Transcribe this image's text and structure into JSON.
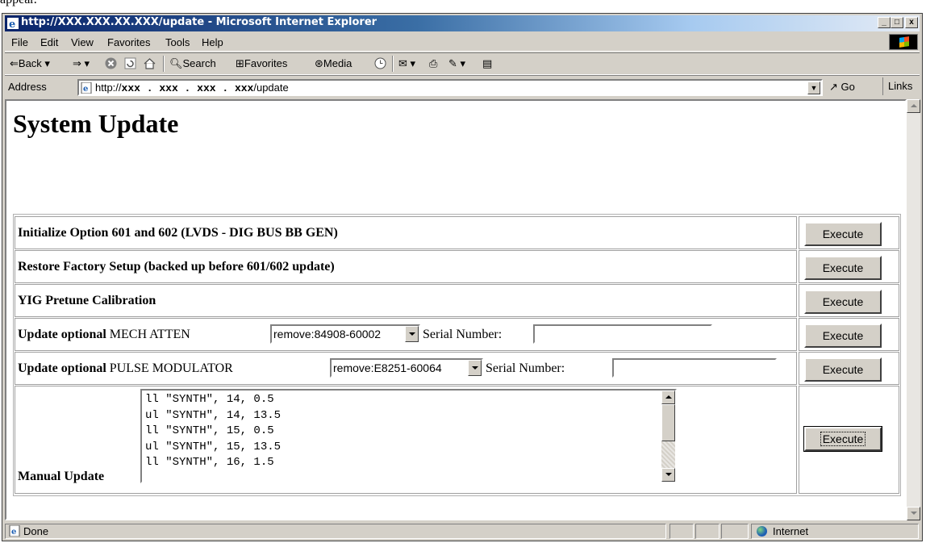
{
  "window": {
    "title": "http://XXX.XXX.XX.XXX/update - Microsoft Internet Explorer",
    "caption_buttons": {
      "minimize": "_",
      "maximize": "□",
      "close": "x"
    }
  },
  "menu": [
    {
      "label": "File"
    },
    {
      "label": "Edit"
    },
    {
      "label": "View"
    },
    {
      "label": "Favorites"
    },
    {
      "label": "Tools"
    },
    {
      "label": "Help"
    }
  ],
  "toolbar": {
    "back": "Back",
    "search": "Search",
    "favorites": "Favorites",
    "media": "Media"
  },
  "address": {
    "label": "Address",
    "url_prefix": "http://",
    "url_host": "xxx . xxx . xxx . xxx",
    "url_path": "/update",
    "go": "Go",
    "links": "Links"
  },
  "page": {
    "title": "System Update",
    "rows": [
      {
        "label": "Initialize Option 601 and 602 (LVDS - DIG BUS BB GEN)",
        "button": "Execute"
      },
      {
        "label": "Restore Factory Setup (backed up before 601/602 update)",
        "button": "Execute"
      },
      {
        "label": "YIG Pretune Calibration",
        "button": "Execute"
      },
      {
        "label_bold": "Update optional",
        "label_normal": "MECH ATTEN",
        "select": "remove:84908-60002",
        "serial_label": "Serial Number:",
        "serial_value": "",
        "button": "Execute"
      },
      {
        "label_bold": "Update optional",
        "label_normal": "PULSE MODULATOR",
        "select": "remove:E8251-60064",
        "serial_label": "Serial Number:",
        "serial_value": "",
        "button": "Execute"
      }
    ],
    "manual": {
      "label": "Manual Update",
      "lines": "ll \"SYNTH\", 14, 0.5\nul \"SYNTH\", 14, 13.5\nll \"SYNTH\", 15, 0.5\nul \"SYNTH\", 15, 13.5\nll \"SYNTH\", 16, 1.5",
      "button": "Execute"
    }
  },
  "status": {
    "text": "Done",
    "zone": "Internet"
  }
}
